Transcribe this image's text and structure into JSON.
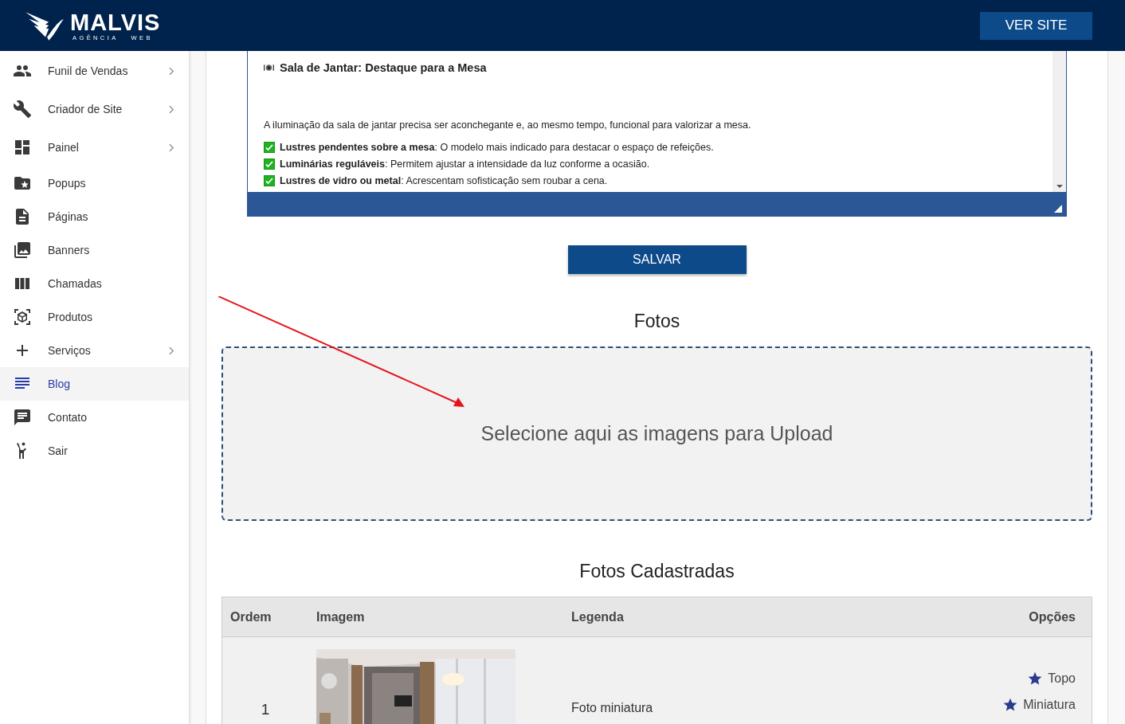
{
  "header": {
    "logo_name": "MALVIS",
    "logo_tagline": "AGÊNCIA   WEB",
    "button": "VER SITE"
  },
  "sidebar": {
    "items": [
      {
        "label": "Funil de Vendas",
        "expandable": true,
        "selected": false
      },
      {
        "label": "Criador de Site",
        "expandable": true,
        "selected": false
      },
      {
        "label": "Painel",
        "expandable": true,
        "selected": false
      },
      {
        "label": "Popups",
        "expandable": false,
        "selected": false
      },
      {
        "label": "Páginas",
        "expandable": false,
        "selected": false
      },
      {
        "label": "Banners",
        "expandable": false,
        "selected": false
      },
      {
        "label": "Chamadas",
        "expandable": false,
        "selected": false
      },
      {
        "label": "Produtos",
        "expandable": false,
        "selected": false
      },
      {
        "label": "Serviços",
        "expandable": true,
        "selected": false
      },
      {
        "label": "Blog",
        "expandable": false,
        "selected": true
      },
      {
        "label": "Contato",
        "expandable": false,
        "selected": false
      },
      {
        "label": "Sair",
        "expandable": false,
        "selected": false
      }
    ]
  },
  "editor": {
    "heading": "Sala de Jantar: Destaque para a Mesa",
    "paragraph": "A iluminação da sala de jantar precisa ser aconchegante e, ao mesmo tempo, funcional para valorizar a mesa.",
    "checklist": [
      "**Lustres pendentes sobre a mesa**: O modelo mais indicado para destacar o espaço de refeições.",
      "**Luminárias reguláveis**: Permitem ajustar a intensidade da luz conforme a ocasião.",
      "**Lustres de vidro ou metal**: Acrescentam sofisticação sem roubar a cena."
    ]
  },
  "save_button": "SALVAR",
  "photos": {
    "title": "Fotos",
    "dropzone": "Selecione aqui as imagens para Upload"
  },
  "registered_photos": {
    "title": "Fotos Cadastradas",
    "columns": [
      "Ordem",
      "Imagem",
      "Legenda",
      "Opções"
    ],
    "rows": [
      {
        "order": "1",
        "image": {
          "kind": "picture"
        },
        "caption": "Foto miniatura",
        "options": [
          "Topo",
          "Miniatura"
        ]
      }
    ]
  }
}
